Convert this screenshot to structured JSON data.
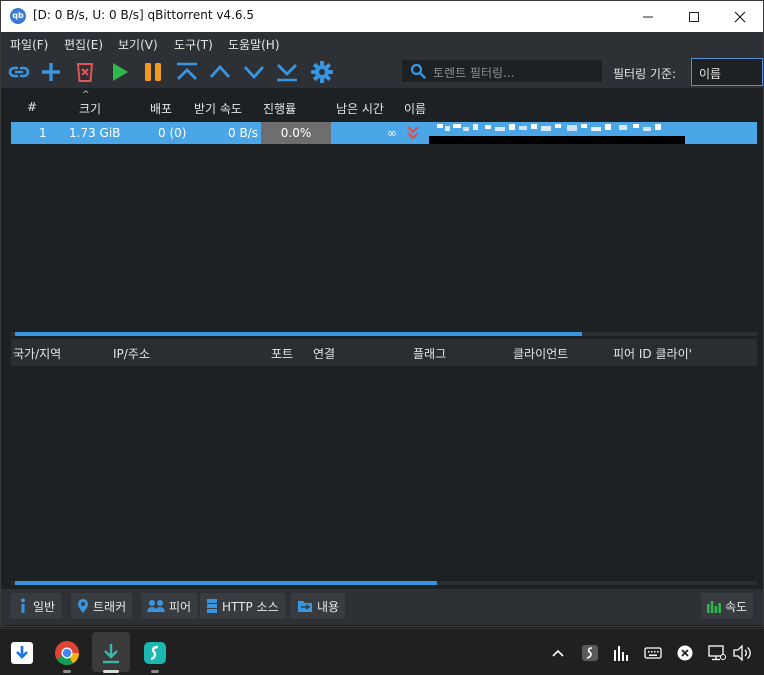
{
  "window": {
    "title": "[D: 0 B/s, U: 0 B/s] qBittorrent v4.6.5",
    "app_icon_text": "qb"
  },
  "menu": [
    "파일(F)",
    "편집(E)",
    "보기(V)",
    "도구(T)",
    "도움말(H)"
  ],
  "toolbar": {
    "icons": [
      "link-icon",
      "add-icon",
      "delete-icon",
      "play-icon",
      "pause-icon",
      "move-top-icon",
      "move-up-icon",
      "move-down-icon",
      "move-bottom-icon",
      "gear-icon"
    ],
    "search_placeholder": "토렌트 필터링...",
    "filter_label": "필터링 기준:",
    "filter_value": "이름"
  },
  "transfer_list": {
    "columns": [
      "#",
      "크기",
      "배포",
      "받기 속도",
      "진행률",
      "남은 시간",
      "이름"
    ],
    "sort_indicator": "^",
    "rows": [
      {
        "index": "1",
        "size": "1.73 GiB",
        "seeds": "0 (0)",
        "down_speed": "0 B/s",
        "progress": "0.0%",
        "progress_value": 0.0,
        "eta": "∞",
        "name": ""
      }
    ]
  },
  "peers": {
    "columns": [
      "국가/지역",
      "IP/주소",
      "포트",
      "연결",
      "플래그",
      "클라이언트",
      "피어 ID 클라이'"
    ]
  },
  "bottom_tabs": {
    "general": "일반",
    "trackers": "트래커",
    "peers": "피어",
    "http_sources": "HTTP 소스",
    "content": "내용",
    "speed": "속도"
  },
  "colors": {
    "accent": "#3a95e0",
    "selection": "#4aa6e6",
    "background": "#1e2124",
    "toolbar_bg": "#2d3035"
  }
}
